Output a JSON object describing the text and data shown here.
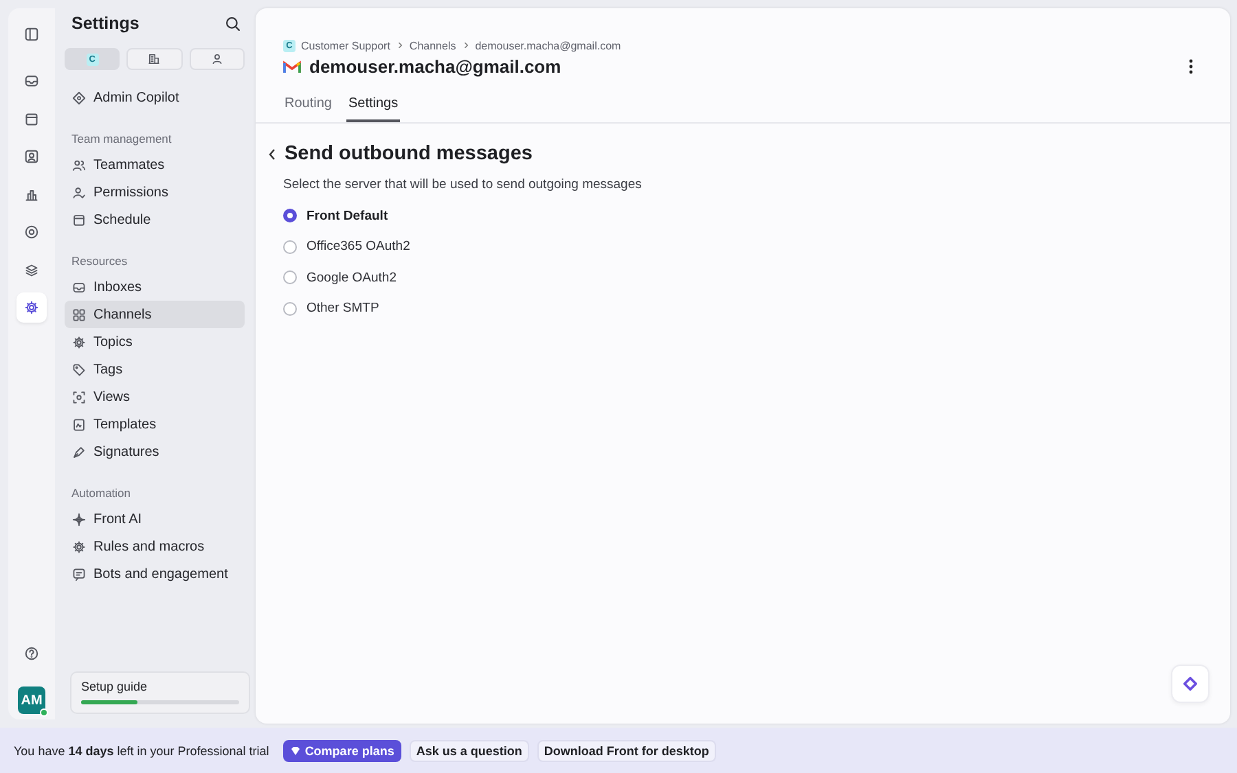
{
  "rail": {
    "items": [
      {
        "kind": "panel",
        "selected": false
      },
      {
        "kind": "inbox",
        "selected": false
      },
      {
        "kind": "calendar",
        "selected": false
      },
      {
        "kind": "contact",
        "selected": false
      },
      {
        "kind": "chart",
        "selected": false
      },
      {
        "kind": "support",
        "selected": false
      },
      {
        "kind": "layers",
        "selected": false
      },
      {
        "kind": "gear",
        "selected": true
      }
    ],
    "help": {
      "kind": "help"
    },
    "avatar": {
      "initials": "AM",
      "online": true
    }
  },
  "sidebar": {
    "title": "Settings",
    "scope_tabs": [
      {
        "badge": "C",
        "selected": true
      },
      {
        "kind": "building",
        "selected": false
      },
      {
        "kind": "person",
        "selected": false
      }
    ],
    "sections": [
      {
        "items": [
          {
            "label": "Admin Copilot",
            "kind": "diamond",
            "selected": false
          }
        ]
      },
      {
        "heading": "Team management",
        "items": [
          {
            "label": "Teammates",
            "kind": "people",
            "selected": false
          },
          {
            "label": "Permissions",
            "kind": "person-check",
            "selected": false
          },
          {
            "label": "Schedule",
            "kind": "calendar",
            "selected": false
          }
        ]
      },
      {
        "heading": "Resources",
        "items": [
          {
            "label": "Inboxes",
            "kind": "inbox",
            "selected": false
          },
          {
            "label": "Channels",
            "kind": "grid",
            "selected": true
          },
          {
            "label": "Topics",
            "kind": "gear",
            "selected": false
          },
          {
            "label": "Tags",
            "kind": "tag",
            "selected": false
          },
          {
            "label": "Views",
            "kind": "view",
            "selected": false
          },
          {
            "label": "Templates",
            "kind": "doc",
            "selected": false
          },
          {
            "label": "Signatures",
            "kind": "pen",
            "selected": false
          }
        ]
      },
      {
        "heading": "Automation",
        "items": [
          {
            "label": "Front AI",
            "kind": "sparkle",
            "selected": false
          },
          {
            "label": "Rules and macros",
            "kind": "gear",
            "selected": false
          },
          {
            "label": "Bots and engagement",
            "kind": "chat",
            "selected": false
          }
        ]
      }
    ],
    "setup_guide": {
      "label": "Setup guide",
      "level": 0.36
    }
  },
  "main": {
    "breadcrumb": [
      {
        "badge": "C",
        "text": "Customer Support"
      },
      {
        "text": "Channels"
      },
      {
        "text": "demouser.macha@gmail.com"
      }
    ],
    "title": "demouser.macha@gmail.com",
    "tabs": [
      {
        "label": "Routing",
        "selected": false
      },
      {
        "label": "Settings",
        "selected": true
      }
    ],
    "section_title": "Send outbound messages",
    "description": "Select the server that will be used to send outgoing messages",
    "options": [
      {
        "label": "Front Default",
        "selected": true
      },
      {
        "label": "Office365 OAuth2",
        "selected": false
      },
      {
        "label": "Google OAuth2",
        "selected": false
      },
      {
        "label": "Other SMTP",
        "selected": false
      }
    ]
  },
  "trial_bar": {
    "message": "You have **14 days** left in your Professional trial",
    "buttons": [
      {
        "label": "Compare plans",
        "kind": "primary"
      },
      {
        "label": "Ask us a question",
        "kind": "plain"
      },
      {
        "label": "Download Front for desktop",
        "kind": "plain"
      }
    ]
  }
}
